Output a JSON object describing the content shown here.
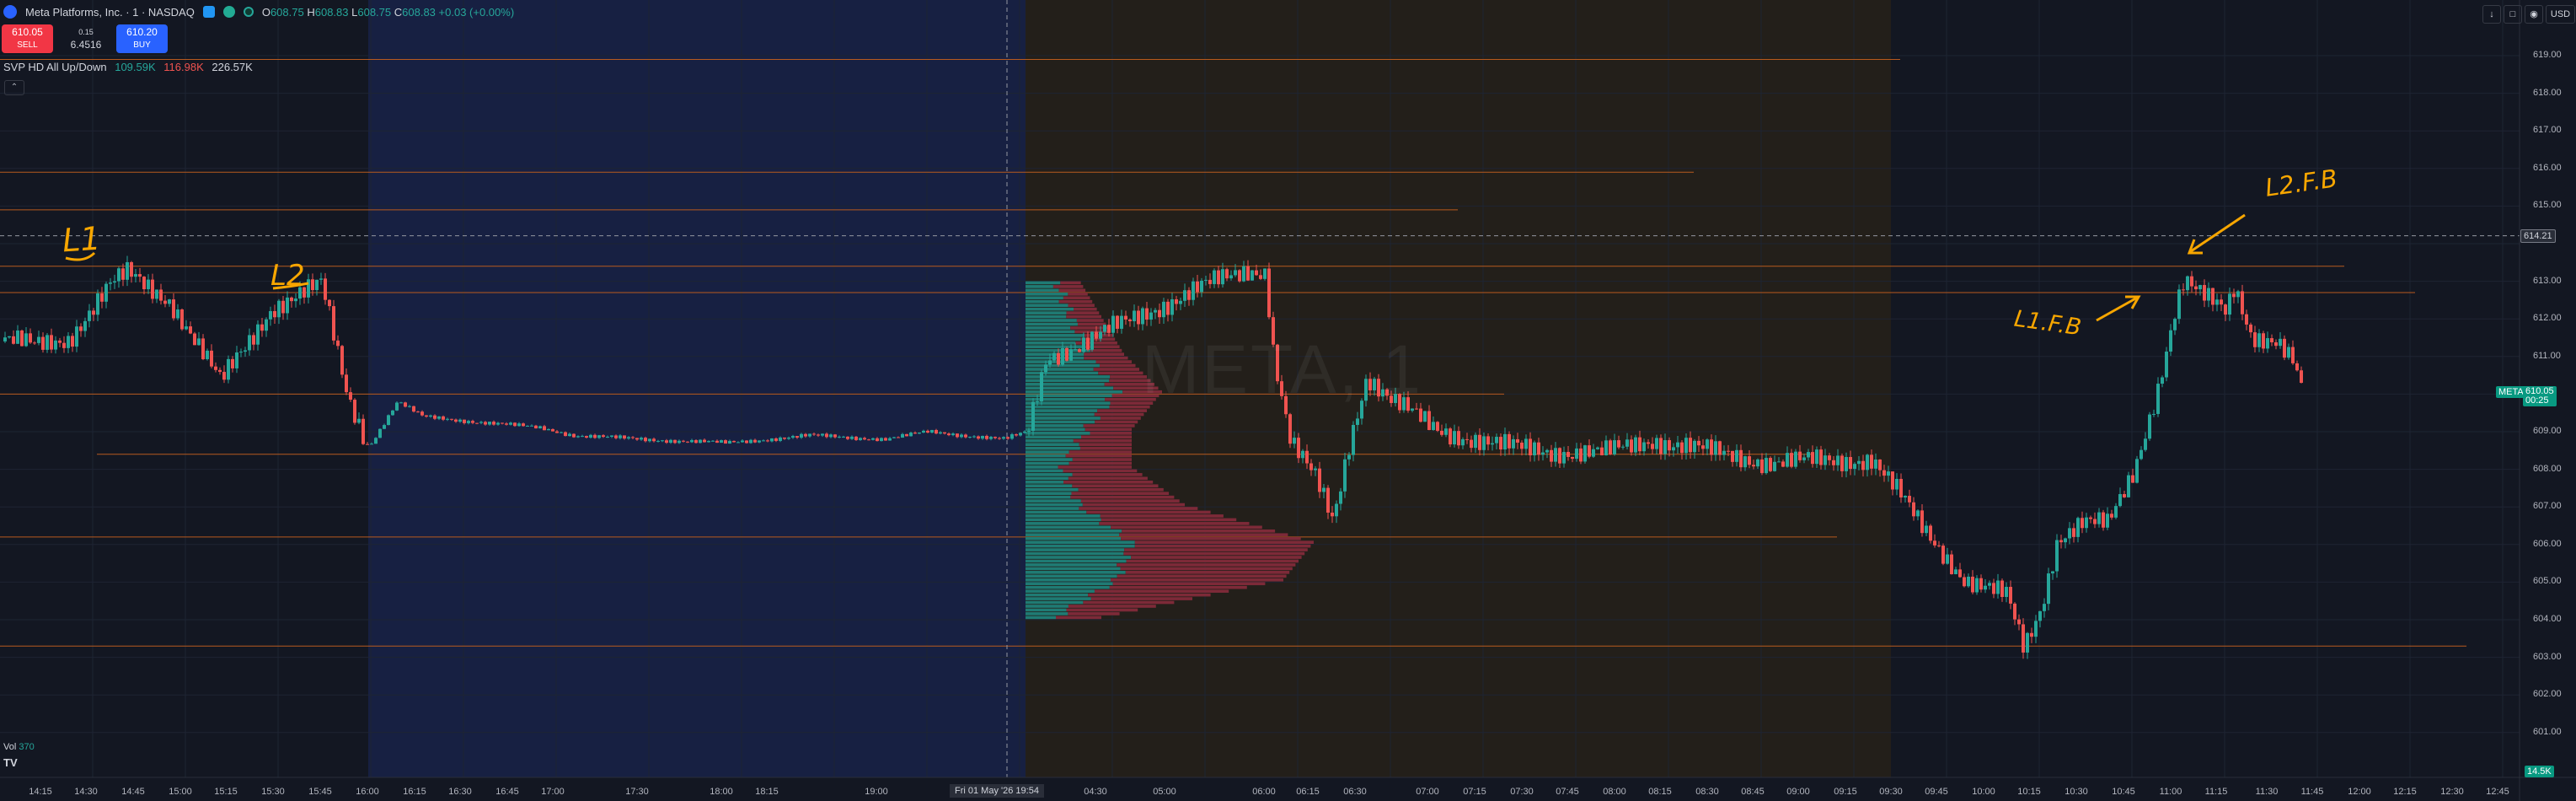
{
  "header": {
    "title": "Meta Platforms, Inc. · 1 · NASDAQ",
    "ohlc": [
      {
        "k": "O",
        "v": "608.75"
      },
      {
        "k": "H",
        "v": "608.83"
      },
      {
        "k": "L",
        "v": "608.75"
      },
      {
        "k": "C",
        "v": "608.83"
      }
    ],
    "change": "+0.03 (+0.00%)"
  },
  "trade": {
    "sell_price": "610.05",
    "sell_label": "SELL",
    "spread_top": "0.15",
    "spread": "6.4516",
    "buy_price": "610.20",
    "buy_label": "BUY"
  },
  "indicator": {
    "name": "SVP HD All Up/Down",
    "up": "109.59K",
    "down": "116.98K",
    "total": "226.57K"
  },
  "top_right": {
    "currency": "USD"
  },
  "watermark": "META, 1",
  "price_axis": {
    "ticks": [
      "619.00",
      "618.00",
      "617.00",
      "616.00",
      "615.00",
      "613.00",
      "612.00",
      "611.00",
      "609.00",
      "608.00",
      "607.00",
      "606.00",
      "605.00",
      "604.00",
      "603.00",
      "602.00",
      "601.00"
    ],
    "crosshair_price": "614.21",
    "last_symbol": "META",
    "last_price": "610.05",
    "countdown": "00:25",
    "volume_tag": "14.5K"
  },
  "time_axis": {
    "ticks": [
      "14:15",
      "14:30",
      "14:45",
      "15:00",
      "15:15",
      "15:30",
      "15:45",
      "16:00",
      "16:15",
      "16:30",
      "16:45",
      "17:00",
      "17:30",
      "18:00",
      "18:15",
      "19:00",
      "04:30",
      "05:00",
      "06:00",
      "06:15",
      "06:30",
      "07:00",
      "07:15",
      "07:30",
      "07:45",
      "08:00",
      "08:15",
      "08:30",
      "08:45",
      "09:00",
      "09:15",
      "09:30",
      "09:45",
      "10:00",
      "10:15",
      "10:30",
      "10:45",
      "11:00",
      "11:15",
      "11:30",
      "11:45",
      "12:00",
      "12:15",
      "12:30",
      "12:45"
    ],
    "crosshair_date": "Fri 01 May '26",
    "crosshair_time": "19:54"
  },
  "volume_legend": {
    "label": "Vol",
    "value": "370"
  },
  "annotations": {
    "l1": "L1",
    "l2": "L2",
    "l1fb": "L1.F.B",
    "l2fb": "L2.F.B"
  },
  "colors": {
    "background": "#131722",
    "up": "#26a69a",
    "down": "#ef5350",
    "level_line": "#b85a1e",
    "annotation": "#f7a600",
    "buy_button": "#2962ff",
    "sell_button": "#f23645"
  },
  "chart_data": {
    "type": "candlestick",
    "symbol": "META",
    "interval": "1",
    "ylim": [
      600.5,
      619.6
    ],
    "horizontal_levels": [
      618.9,
      615.9,
      614.9,
      613.4,
      612.7,
      610.0,
      608.4,
      606.2,
      603.3
    ],
    "volume_profile": {
      "bins": [
        604.0,
        605.0,
        606.0,
        607.0,
        608.0,
        609.0,
        610.0,
        611.0,
        612.0,
        613.0
      ],
      "up_volume": [
        4,
        12,
        14,
        7,
        5,
        8,
        12,
        8,
        6,
        4
      ],
      "down_volume": [
        6,
        22,
        24,
        14,
        9,
        6,
        6,
        5,
        4,
        3
      ]
    }
  }
}
